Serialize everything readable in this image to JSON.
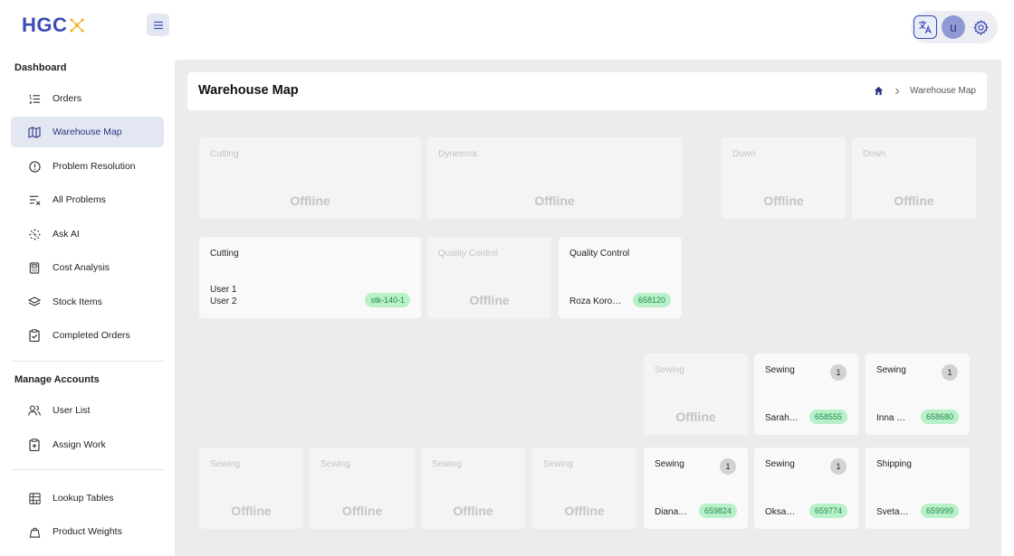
{
  "app": {
    "logo_text": "HGC"
  },
  "topbar": {
    "avatar_initial": "u"
  },
  "sidebar": {
    "section_dashboard": "Dashboard",
    "section_accounts": "Manage Accounts",
    "items": [
      {
        "label": "Orders",
        "icon": "list-ordered-icon"
      },
      {
        "label": "Warehouse Map",
        "icon": "map-icon",
        "active": true
      },
      {
        "label": "Problem Resolution",
        "icon": "alert-circle-icon"
      },
      {
        "label": "All Problems",
        "icon": "filter-list-icon"
      },
      {
        "label": "Ask AI",
        "icon": "sparkle-dots-icon"
      },
      {
        "label": "Cost Analysis",
        "icon": "calculator-icon"
      },
      {
        "label": "Stock Items",
        "icon": "layers-icon"
      },
      {
        "label": "Completed Orders",
        "icon": "clipboard-check-icon"
      },
      {
        "label": "User List",
        "icon": "users-icon"
      },
      {
        "label": "Assign Work",
        "icon": "clipboard-plus-icon"
      },
      {
        "label": "Lookup Tables",
        "icon": "table-icon"
      },
      {
        "label": "Product Weights",
        "icon": "weight-icon"
      }
    ]
  },
  "header": {
    "title": "Warehouse Map",
    "breadcrumb_current": "Warehouse Map"
  },
  "offline_label": "Offline",
  "tiles": [
    {
      "name": "Cutting",
      "status": "offline"
    },
    {
      "name": "Dyneema",
      "status": "offline"
    },
    {
      "name": "Down",
      "status": "offline"
    },
    {
      "name": "Down",
      "status": "offline"
    },
    {
      "name": "Cutting",
      "status": "online",
      "users": [
        "User 1",
        "User 2"
      ],
      "tag": "stk-140-1"
    },
    {
      "name": "Quality Control",
      "status": "offline"
    },
    {
      "name": "Quality Control",
      "status": "online",
      "person": "Roza Koro…",
      "order": "658120"
    },
    {
      "name": "Sewing",
      "status": "offline"
    },
    {
      "name": "Sewing",
      "status": "online",
      "count": "1",
      "person": "Sarah…",
      "order": "658555"
    },
    {
      "name": "Sewing",
      "status": "online",
      "count": "1",
      "person": "Inna …",
      "order": "658680"
    },
    {
      "name": "Sewing",
      "status": "offline"
    },
    {
      "name": "Sewing",
      "status": "offline"
    },
    {
      "name": "Sewing",
      "status": "offline"
    },
    {
      "name": "Sewing",
      "status": "offline"
    },
    {
      "name": "Sewing",
      "status": "online",
      "count": "1",
      "person": "Diana…",
      "order": "659824"
    },
    {
      "name": "Sewing",
      "status": "online",
      "count": "1",
      "person": "Oksa…",
      "order": "659774"
    },
    {
      "name": "Shipping",
      "status": "online",
      "person": "Sveta…",
      "order": "659999"
    }
  ]
}
